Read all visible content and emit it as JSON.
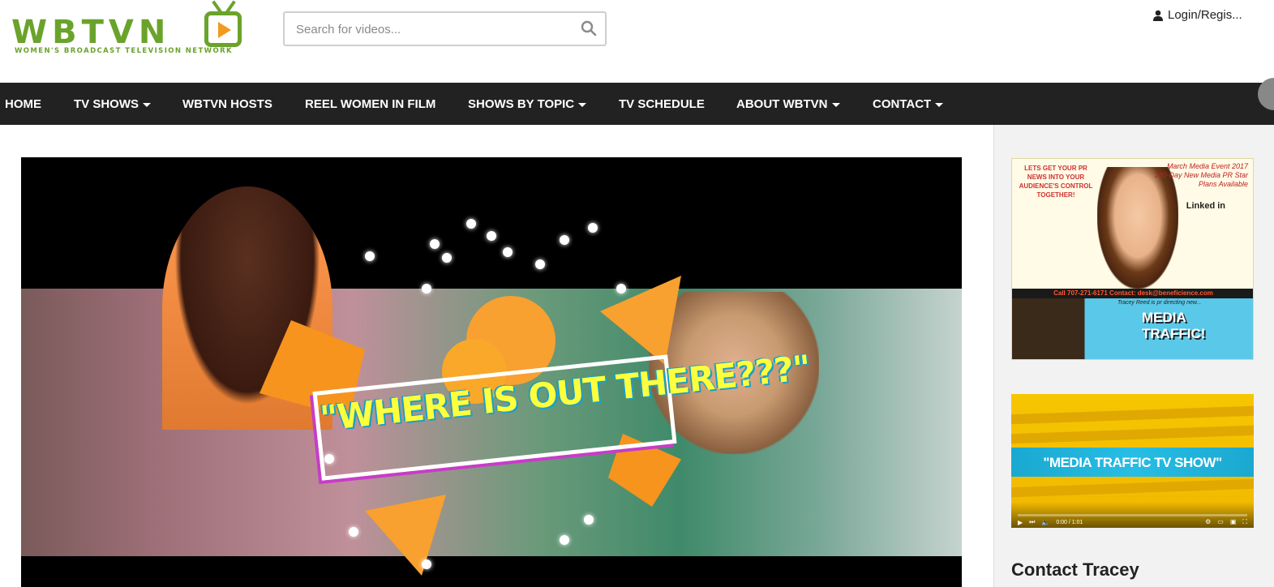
{
  "logo": {
    "text": "WBTVN",
    "tagline": "WOMEN'S BROADCAST TELEVISION NETWORK"
  },
  "search": {
    "placeholder": "Search for videos...",
    "icon": "search-icon"
  },
  "header": {
    "login_label": "Login/Regis..."
  },
  "nav": {
    "items": [
      {
        "label": "HOME",
        "dropdown": false
      },
      {
        "label": "TV SHOWS",
        "dropdown": true
      },
      {
        "label": "WBTVN HOSTS",
        "dropdown": false
      },
      {
        "label": "REEL WOMEN IN FILM",
        "dropdown": false
      },
      {
        "label": "SHOWS BY TOPIC",
        "dropdown": true
      },
      {
        "label": "TV SCHEDULE",
        "dropdown": false
      },
      {
        "label": "ABOUT WBTVN",
        "dropdown": true
      },
      {
        "label": "CONTACT",
        "dropdown": true
      }
    ]
  },
  "video": {
    "title_overlay": "\"WHERE IS OUT THERE???\""
  },
  "sidebar": {
    "ad1": {
      "left_text": "LETS GET YOUR PR NEWS INTO YOUR AUDIENCE'S CONTROL TOGETHER!",
      "right_text": "March Media Event 2017 180-Day New Media PR Star Plans Available",
      "linkedin": "Linked in",
      "contact_line": "Call 707-271-6171 Contact: desk@beneficience.com",
      "tagline": "Tracey Reed is pr directing new...",
      "traffic_title": "MEDIA TRAFFIC!"
    },
    "ad2": {
      "title": "\"MEDIA TRAFFIC TV SHOW\"",
      "time": "0:00 / 1:01"
    },
    "contact_heading": "Contact Tracey"
  },
  "colors": {
    "brand_green": "#6aa32b",
    "accent_orange": "#f29a1f",
    "nav_bg": "#222222"
  }
}
